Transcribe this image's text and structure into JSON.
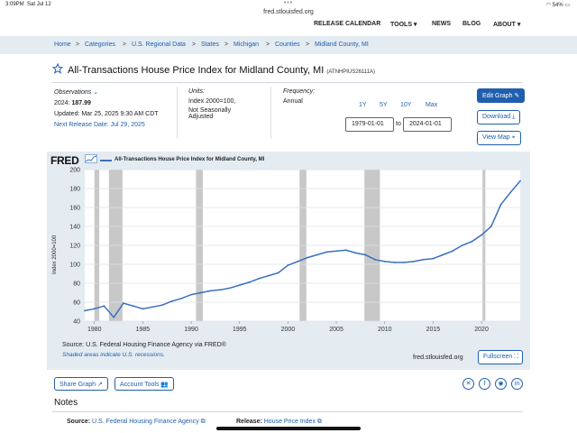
{
  "status": {
    "time": "3:09PM",
    "date": "Sat Jul 12",
    "url": "fred.stlouisfed.org",
    "battery": "54%"
  },
  "nav": {
    "items": [
      "RELEASE CALENDAR",
      "TOOLS ▾",
      "NEWS",
      "BLOG",
      "ABOUT ▾"
    ]
  },
  "breadcrumb": [
    "Home",
    "Categories",
    "U.S. Regional Data",
    "States",
    "Michigan",
    "Counties",
    "Midland County, MI"
  ],
  "series": {
    "title": "All-Transactions House Price Index for Midland County, MI",
    "id": "(ATNHPIUS26111A)"
  },
  "observations": {
    "label": "Observations",
    "year": "2024:",
    "value": "187.99",
    "updated": "Updated: Mar 25, 2025 9:30 AM CDT",
    "next_release": "Next Release Date: Jul 29, 2025"
  },
  "units": {
    "label": "Units:",
    "line1": "Index 2000=100,",
    "line2": "Not Seasonally",
    "line3": "Adjusted"
  },
  "frequency": {
    "label": "Frequency:",
    "value": "Annual"
  },
  "ranges": [
    "1Y",
    "5Y",
    "10Y",
    "Max"
  ],
  "dates": {
    "start": "1979-01-01",
    "to": "to",
    "end": "2024-01-01"
  },
  "buttons": {
    "edit": "Edit Graph",
    "download": "Download",
    "map": "View Map",
    "fullscreen": "Fullscreen",
    "share": "Share Graph",
    "account": "Account Tools"
  },
  "chart_meta": {
    "logo": "FRED",
    "source": "Source: U.S. Federal Housing Finance Agency via FRED®",
    "shaded": "Shaded areas indicate U.S. recessions.",
    "site": "fred.stlouisfed.org"
  },
  "notes": {
    "title": "Notes",
    "source_label": "Source:",
    "source_value": "U.S. Federal Housing Finance Agency",
    "release_label": "Release:",
    "release_value": "House Price Index"
  },
  "colors": {
    "line": "#3b6fbf",
    "link": "#1f5fae",
    "panel": "#e4ecf2",
    "recession": "#c8c8c8"
  },
  "chart_data": {
    "type": "line",
    "title": "All-Transactions House Price Index for Midland County, MI",
    "xlabel": "",
    "ylabel": "Index 2000=100",
    "xlim": [
      1979,
      2024
    ],
    "ylim": [
      40,
      200
    ],
    "yticks": [
      40,
      60,
      80,
      100,
      120,
      140,
      160,
      180,
      200
    ],
    "xticks": [
      1980,
      1985,
      1990,
      1995,
      2000,
      2005,
      2010,
      2015,
      2020
    ],
    "grid": true,
    "legend_position": "top-left",
    "recessions": [
      [
        1980.0,
        1980.5
      ],
      [
        1981.5,
        1982.9
      ],
      [
        1990.5,
        1991.2
      ],
      [
        2001.2,
        2001.9
      ],
      [
        2007.9,
        2009.5
      ],
      [
        2020.1,
        2020.4
      ]
    ],
    "series": [
      {
        "name": "All-Transactions House Price Index for Midland County, MI",
        "x": [
          1979,
          1980,
          1981,
          1982,
          1983,
          1984,
          1985,
          1986,
          1987,
          1988,
          1989,
          1990,
          1991,
          1992,
          1993,
          1994,
          1995,
          1996,
          1997,
          1998,
          1999,
          2000,
          2001,
          2002,
          2003,
          2004,
          2005,
          2006,
          2007,
          2008,
          2009,
          2010,
          2011,
          2012,
          2013,
          2014,
          2015,
          2016,
          2017,
          2018,
          2019,
          2020,
          2021,
          2022,
          2023,
          2024
        ],
        "values": [
          51,
          53,
          56,
          44,
          59,
          56,
          53,
          55,
          57,
          61,
          64,
          68,
          70,
          72,
          73,
          75,
          78,
          81,
          85,
          88,
          91,
          99,
          103,
          107,
          110,
          113,
          114,
          115,
          112,
          110,
          105,
          103,
          102,
          102,
          103,
          105,
          106,
          110,
          114,
          120,
          124,
          131,
          140,
          163,
          176,
          188
        ]
      }
    ]
  }
}
